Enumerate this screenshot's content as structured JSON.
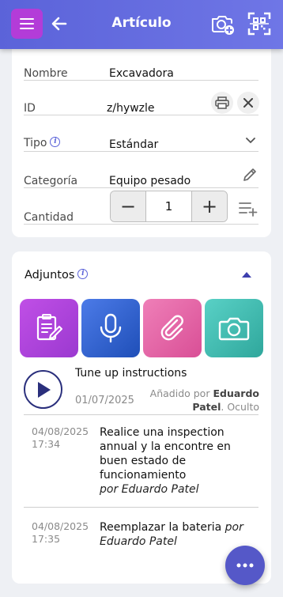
{
  "header": {
    "title": "Artículo",
    "menu_icon": "hamburger-menu-icon",
    "back_icon": "arrow-left-icon",
    "camera_icon": "camera-add-icon",
    "qr_icon": "qr-scan-icon",
    "menu_color": "#b33cd8",
    "bar_color": "#5b63d9"
  },
  "details": {
    "nombre": {
      "label": "Nombre",
      "value": "Excavadora"
    },
    "id": {
      "label": "ID",
      "value": "z/hywzle"
    },
    "tipo": {
      "label": "Tipo",
      "value": "Estándar"
    },
    "categoria": {
      "label": "Categoría",
      "value": "Equipo pesado"
    },
    "cantidad": {
      "label": "Cantidad",
      "value": "1",
      "minus": "−",
      "plus": "+"
    }
  },
  "attachments": {
    "title": "Adjuntos",
    "tiles": [
      "note-edit-icon",
      "microphone-icon",
      "paperclip-icon",
      "camera-icon"
    ],
    "audio": {
      "title": "Tune up instructions",
      "date": "01/07/2025",
      "added_prefix": "Añadido por",
      "author": "Eduardo Patel",
      "visibility": "Oculto"
    },
    "notes": [
      {
        "date": "04/08/2025 17:34",
        "text": "Realice una inspection annual y la encontre en buen estado de funcionamiento",
        "by": "por Eduardo Patel"
      },
      {
        "date": "04/08/2025 17:35",
        "text": "Reemplazar la bateria",
        "by": "por Eduardo Patel"
      }
    ]
  },
  "fab": {
    "icon": "more-dots-icon",
    "color": "#5558c8"
  }
}
